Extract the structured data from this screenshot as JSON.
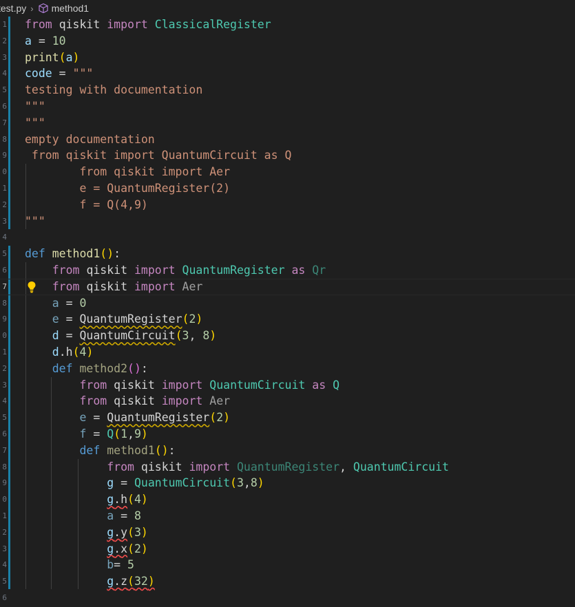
{
  "breadcrumb": {
    "file": "test.py",
    "separator": "›",
    "symbol": "method1"
  },
  "gutter": {
    "numbers": [
      "1",
      "2",
      "3",
      "4",
      "5",
      "6",
      "7",
      "8",
      "9",
      "0",
      "1",
      "2",
      "3",
      "4",
      "5",
      "6",
      "7",
      "8",
      "9",
      "0",
      "1",
      "2",
      "3",
      "4",
      "5",
      "6",
      "7",
      "8",
      "9",
      "0",
      "1",
      "2",
      "3",
      "4",
      "5",
      "6"
    ]
  },
  "colors": {
    "background": "#1f1f1f",
    "keyword": "#569cd6",
    "control": "#c586c0",
    "string": "#ce9178",
    "class": "#4ec9b0",
    "variable": "#9cdcfe",
    "number": "#b5cea8",
    "modified_marker": "#1b81a8"
  },
  "icons": {
    "breadcrumb_symbol": "cube-icon",
    "lightbulb": "lightbulb-icon"
  },
  "code": {
    "l1": [
      "from",
      " ",
      "qiskit",
      " ",
      "import",
      " ",
      "ClassicalRegister"
    ],
    "l2": [
      "a",
      " = ",
      "10"
    ],
    "l3": [
      "print",
      "(",
      "a",
      ")"
    ],
    "l4": [
      "code",
      " = ",
      "\"\"\""
    ],
    "l5": "testing with documentation",
    "l6": "\"\"\"",
    "l7": "\"\"\"",
    "l8": "empty documentation",
    "l9": " from qiskit import QuantumCircuit as Q",
    "l10": "        from qiskit import Aer",
    "l11": "        e = QuantumRegister(2)",
    "l12": "        f = Q(4,9)",
    "l13": "\"\"\"",
    "l15": [
      "def",
      " ",
      "method1",
      "(",
      ")",
      ":"
    ],
    "l16": [
      "    ",
      "from",
      " ",
      "qiskit",
      " ",
      "import",
      " ",
      "QuantumRegister",
      " ",
      "as",
      " ",
      "Qr"
    ],
    "l17": [
      "    ",
      "from",
      " ",
      "qiskit",
      " ",
      "import",
      " ",
      "Aer"
    ],
    "l18": [
      "    ",
      "a",
      " = ",
      "0"
    ],
    "l19": [
      "    ",
      "e",
      " = ",
      "QuantumRegister",
      "(",
      "2",
      ")"
    ],
    "l20": [
      "    ",
      "d",
      " = ",
      "QuantumCircuit",
      "(",
      "3",
      ", ",
      "8",
      ")"
    ],
    "l21": [
      "    ",
      "d",
      ".",
      "h",
      "(",
      "4",
      ")"
    ],
    "l22": [
      "    ",
      "def",
      " ",
      "method2",
      "(",
      ")",
      ":"
    ],
    "l23": [
      "        ",
      "from",
      " ",
      "qiskit",
      " ",
      "import",
      " ",
      "QuantumCircuit",
      " ",
      "as",
      " ",
      "Q"
    ],
    "l24": [
      "        ",
      "from",
      " ",
      "qiskit",
      " ",
      "import",
      " ",
      "Aer"
    ],
    "l25": [
      "        ",
      "e",
      " = ",
      "QuantumRegister",
      "(",
      "2",
      ")"
    ],
    "l26": [
      "        ",
      "f",
      " = ",
      "Q",
      "(",
      "1",
      ",",
      "9",
      ")"
    ],
    "l27": [
      "        ",
      "def",
      " ",
      "method1",
      "(",
      ")",
      ":"
    ],
    "l28": [
      "            ",
      "from",
      " ",
      "qiskit",
      " ",
      "import",
      " ",
      "QuantumRegister",
      ", ",
      "QuantumCircuit"
    ],
    "l29": [
      "            ",
      "g",
      " = ",
      "QuantumCircuit",
      "(",
      "3",
      ",",
      "8",
      ")"
    ],
    "l30": [
      "            ",
      "g",
      ".",
      "h",
      "(",
      "4",
      ")"
    ],
    "l31": [
      "            ",
      "a",
      " = ",
      "8"
    ],
    "l32": [
      "            ",
      "g",
      ".",
      "y",
      "(",
      "3",
      ")"
    ],
    "l33": [
      "            ",
      "g",
      ".",
      "x",
      "(",
      "2",
      ")"
    ],
    "l34": [
      "            ",
      "b",
      "= ",
      "5"
    ],
    "l35": [
      "            ",
      "g",
      ".",
      "z",
      "(",
      "32",
      ")"
    ]
  }
}
